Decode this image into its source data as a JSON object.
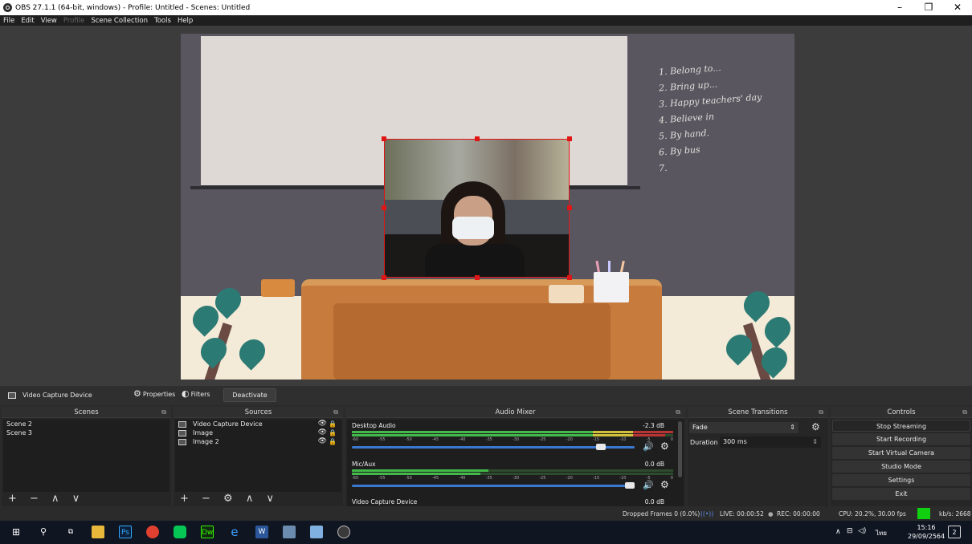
{
  "window": {
    "title": "OBS 27.1.1 (64-bit, windows) - Profile: Untitled - Scenes: Untitled",
    "minimize": "–",
    "maximize": "❐",
    "close": "✕"
  },
  "menu": [
    "File",
    "Edit",
    "View",
    "Profile",
    "Scene Collection",
    "Tools",
    "Help"
  ],
  "menu_disabled": "Profile",
  "preview": {
    "chalk_lines": [
      "1. Belong to...",
      "2. Bring up...",
      "3. Happy teachers' day",
      "4. Believe in",
      "5. By hand.",
      "6. By bus",
      "7."
    ]
  },
  "source_bar": {
    "selected_source": "Video Capture Device",
    "properties_label": "Properties",
    "filters_label": "Filters",
    "deactivate_label": "Deactivate"
  },
  "scenes": {
    "header": "Scenes",
    "items": [
      "Scene 2",
      "Scene 3"
    ],
    "footer": "+ − ∧ ∨"
  },
  "sources": {
    "header": "Sources",
    "items": [
      "Video Capture Device",
      "Image",
      "Image 2"
    ],
    "footer": "+ − ⚙ ∧ ∨"
  },
  "audio_mixer": {
    "header": "Audio Mixer",
    "channels": [
      {
        "name": "Desktop Audio",
        "db": "-2.3 dB"
      },
      {
        "name": "Mic/Aux",
        "db": "0.0 dB"
      },
      {
        "name": "Video Capture Device",
        "db": "0.0 dB"
      }
    ],
    "scale": [
      "-60",
      "-55",
      "-50",
      "-45",
      "-40",
      "-35",
      "-30",
      "-25",
      "-20",
      "-15",
      "-10",
      "-5",
      "0"
    ]
  },
  "scene_transitions": {
    "header": "Scene Transitions",
    "transition": "Fade",
    "duration_label": "Duration",
    "duration_value": "300 ms"
  },
  "controls": {
    "header": "Controls",
    "buttons": [
      "Stop Streaming",
      "Start Recording",
      "Start Virtual Camera",
      "Studio Mode",
      "Settings",
      "Exit"
    ]
  },
  "status": {
    "dropped": "Dropped Frames 0 (0.0%)",
    "live": "LIVE: 00:00:52",
    "rec": "REC: 00:00:00",
    "cpu": "CPU: 20.2%, 30.00 fps",
    "kbps": "kb/s: 2668"
  },
  "taskbar": {
    "time": "15:16",
    "date": "29/09/2564",
    "lang": "ไทย",
    "notif_count": "2",
    "apps": [
      "Ps",
      "Dw",
      "W"
    ]
  },
  "colors": {
    "selection": "#e01515",
    "meter_green": "#43b94a",
    "meter_yellow": "#cfc13a",
    "meter_red": "#b93434",
    "volume_slider": "#3b79d0",
    "kbps_indicator": "#10d010"
  }
}
